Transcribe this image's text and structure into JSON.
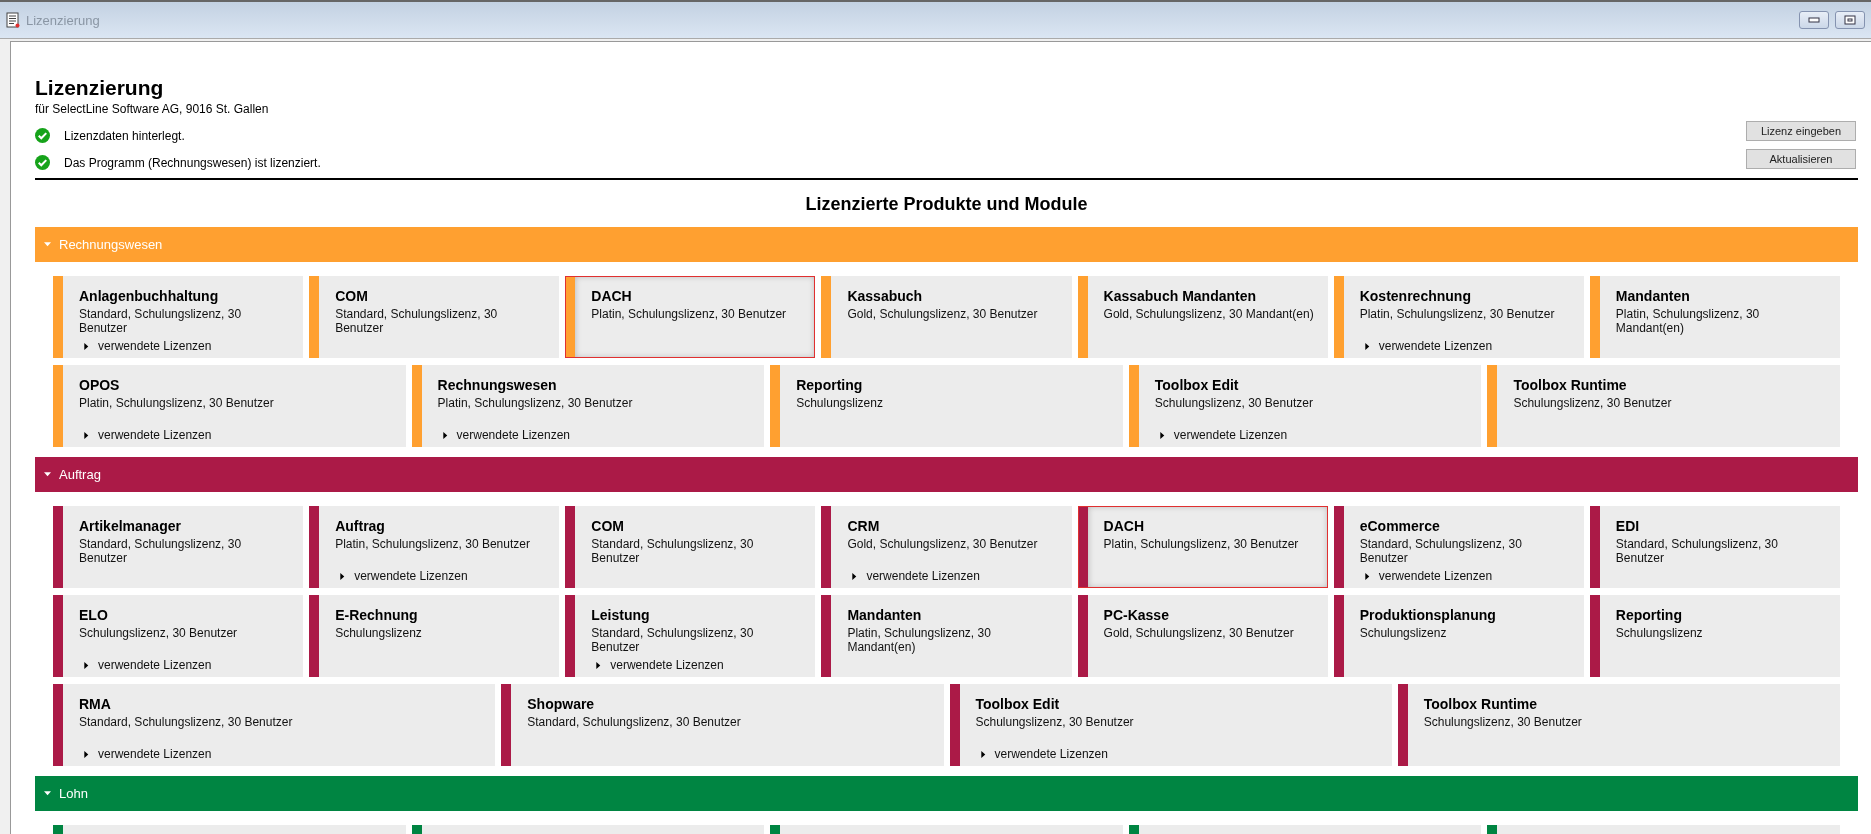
{
  "window": {
    "title": "Lizenzierung"
  },
  "header": {
    "title": "Lizenzierung",
    "subtitle": "für SelectLine Software AG, 9016 St. Gallen",
    "status": [
      {
        "text": "Lizenzdaten hinterlegt.",
        "ok": true
      },
      {
        "text": "Das Programm (Rechnungswesen) ist lizenziert.",
        "ok": true
      }
    ],
    "buttons": [
      "Lizenz eingeben",
      "Aktualisieren"
    ]
  },
  "heading": "Lizenzierte Produkte und Module",
  "sections": [
    {
      "title": "Rechnungswesen",
      "color": "#ffa030",
      "expanded": true,
      "rows": [
        {
          "tiles": [
            {
              "name": "Anlagenbuchhaltung",
              "detail": "Standard, Schulungslizenz, 30 Benutzer",
              "expander": "verwendete Lizenzen",
              "selected": false
            },
            {
              "name": "COM",
              "detail": "Standard, Schulungslizenz, 30 Benutzer",
              "selected": false
            },
            {
              "name": "DACH",
              "detail": "Platin, Schulungslizenz, 30 Benutzer",
              "selected": true
            },
            {
              "name": "Kassabuch",
              "detail": "Gold, Schulungslizenz, 30 Benutzer",
              "selected": false
            },
            {
              "name": "Kassabuch Mandanten",
              "detail": "Gold, Schulungslizenz, 30 Mandant(en)",
              "selected": false
            },
            {
              "name": "Kostenrechnung",
              "detail": "Platin, Schulungslizenz, 30 Benutzer",
              "expander": "verwendete Lizenzen",
              "selected": false
            },
            {
              "name": "Mandanten",
              "detail": "Platin, Schulungslizenz, 30 Mandant(en)",
              "selected": false
            }
          ]
        },
        {
          "tiles": [
            {
              "name": "OPOS",
              "detail": "Platin, Schulungslizenz, 30 Benutzer",
              "expander": "verwendete Lizenzen",
              "selected": false
            },
            {
              "name": "Rechnungswesen",
              "detail": "Platin, Schulungslizenz, 30 Benutzer",
              "expander": "verwendete Lizenzen",
              "selected": false
            },
            {
              "name": "Reporting",
              "detail": "Schulungslizenz",
              "selected": false
            },
            {
              "name": "Toolbox Edit",
              "detail": "Schulungslizenz, 30 Benutzer",
              "expander": "verwendete Lizenzen",
              "selected": false
            },
            {
              "name": "Toolbox Runtime",
              "detail": "Schulungslizenz, 30 Benutzer",
              "selected": false
            }
          ]
        }
      ]
    },
    {
      "title": "Auftrag",
      "color": "#ab1a47",
      "expanded": true,
      "rows": [
        {
          "tiles": [
            {
              "name": "Artikelmanager",
              "detail": "Standard, Schulungslizenz, 30 Benutzer",
              "selected": false
            },
            {
              "name": "Auftrag",
              "detail": "Platin, Schulungslizenz, 30 Benutzer",
              "expander": "verwendete Lizenzen",
              "selected": false
            },
            {
              "name": "COM",
              "detail": "Standard, Schulungslizenz, 30 Benutzer",
              "selected": false
            },
            {
              "name": "CRM",
              "detail": "Gold, Schulungslizenz, 30 Benutzer",
              "expander": "verwendete Lizenzen",
              "selected": false
            },
            {
              "name": "DACH",
              "detail": "Platin, Schulungslizenz, 30 Benutzer",
              "selected": true
            },
            {
              "name": "eCommerce",
              "detail": "Standard, Schulungslizenz, 30 Benutzer",
              "expander": "verwendete Lizenzen",
              "selected": false
            },
            {
              "name": "EDI",
              "detail": "Standard, Schulungslizenz, 30 Benutzer",
              "selected": false
            }
          ]
        },
        {
          "tiles": [
            {
              "name": "ELO",
              "detail": "Schulungslizenz, 30 Benutzer",
              "expander": "verwendete Lizenzen",
              "selected": false
            },
            {
              "name": "E-Rechnung",
              "detail": "Schulungslizenz",
              "selected": false
            },
            {
              "name": "Leistung",
              "detail": "Standard, Schulungslizenz, 30 Benutzer",
              "expander": "verwendete Lizenzen",
              "selected": false
            },
            {
              "name": "Mandanten",
              "detail": "Platin, Schulungslizenz, 30 Mandant(en)",
              "selected": false
            },
            {
              "name": "PC-Kasse",
              "detail": "Gold, Schulungslizenz, 30 Benutzer",
              "selected": false
            },
            {
              "name": "Produktionsplanung",
              "detail": "Schulungslizenz",
              "selected": false
            },
            {
              "name": "Reporting",
              "detail": "Schulungslizenz",
              "selected": false
            }
          ]
        },
        {
          "tiles": [
            {
              "name": "RMA",
              "detail": "Standard, Schulungslizenz, 30 Benutzer",
              "expander": "verwendete Lizenzen",
              "selected": false
            },
            {
              "name": "Shopware",
              "detail": "Standard, Schulungslizenz, 30 Benutzer",
              "selected": false
            },
            {
              "name": "Toolbox Edit",
              "detail": "Schulungslizenz, 30 Benutzer",
              "expander": "verwendete Lizenzen",
              "selected": false
            },
            {
              "name": "Toolbox Runtime",
              "detail": "Schulungslizenz, 30 Benutzer",
              "selected": false
            }
          ]
        }
      ]
    },
    {
      "title": "Lohn",
      "color": "#008542",
      "expanded": true,
      "rows": [
        {
          "tiles": [
            {
              "selected": false
            },
            {
              "selected": false
            },
            {
              "selected": false
            },
            {
              "selected": false
            },
            {
              "selected": false
            }
          ]
        }
      ]
    }
  ]
}
